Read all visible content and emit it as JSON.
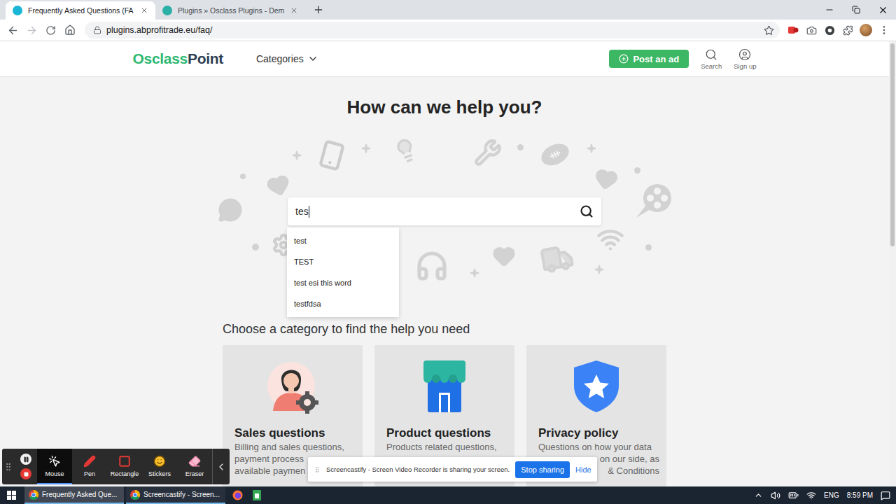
{
  "browser": {
    "tabs": [
      {
        "title": "Frequently Asked Questions (FA",
        "selected": true,
        "color": "#1bb6d6"
      },
      {
        "title": "Plugins » Osclass Plugins - Dem",
        "selected": false,
        "color": "#2bb0a8"
      }
    ],
    "navigation": {
      "back_disabled": false,
      "forward_disabled": true
    },
    "url": "plugins.abprofitrade.eu/faq/"
  },
  "site": {
    "logo": {
      "first": "Osclass",
      "second": "Point"
    },
    "menu": "Categories",
    "post_button": "Post an ad",
    "actions": [
      {
        "label": "Search",
        "kind": "search"
      },
      {
        "label": "Sign up",
        "kind": "user"
      }
    ]
  },
  "hero": {
    "title": "How can we help you?"
  },
  "search": {
    "value": "tes",
    "suggestions": [
      "test",
      "TEST",
      "test esi this word",
      "testfdsa"
    ]
  },
  "categories": {
    "heading": "Choose a category to find the help you need",
    "cards": [
      {
        "kind": "sales",
        "title": "Sales questions",
        "lines": [
          {
            "text": "Billing and sales questions,",
            "cut": "none"
          },
          {
            "text": "payment process",
            "cut": "end"
          },
          {
            "text": "available paymen",
            "cut": "end"
          }
        ]
      },
      {
        "kind": "product",
        "title": "Product questions",
        "lines": [
          {
            "text": "Products related questions,",
            "cut": "none"
          }
        ]
      },
      {
        "kind": "privacy",
        "title": "Privacy policy",
        "lines": [
          {
            "text": "Questions on how your data",
            "cut": "none"
          },
          {
            "text": "on our side, as",
            "cut": "start"
          },
          {
            "text": "& Conditions",
            "cut": "start"
          }
        ]
      }
    ]
  },
  "page_scrollbar": {
    "level": 0.46
  },
  "recorder": {
    "tools": [
      {
        "kind": "mouse",
        "label": "Mouse",
        "selected": true
      },
      {
        "kind": "pen",
        "label": "Pen",
        "selected": false
      },
      {
        "kind": "rectangle",
        "label": "Rectangle",
        "selected": false
      },
      {
        "kind": "stickers",
        "label": "Stickers",
        "selected": false
      },
      {
        "kind": "eraser",
        "label": "Eraser",
        "selected": false
      }
    ]
  },
  "share_banner": {
    "text": "Screencastify - Screen Video Recorder is sharing your screen.",
    "stop_button": "Stop sharing",
    "hide_link": "Hide"
  },
  "taskbar": {
    "items": [
      {
        "label": "Frequently Asked Que...",
        "selected": true
      },
      {
        "label": "Screencastify - Screen...",
        "selected": false
      }
    ],
    "language": "ENG",
    "time": "8:59 PM"
  }
}
